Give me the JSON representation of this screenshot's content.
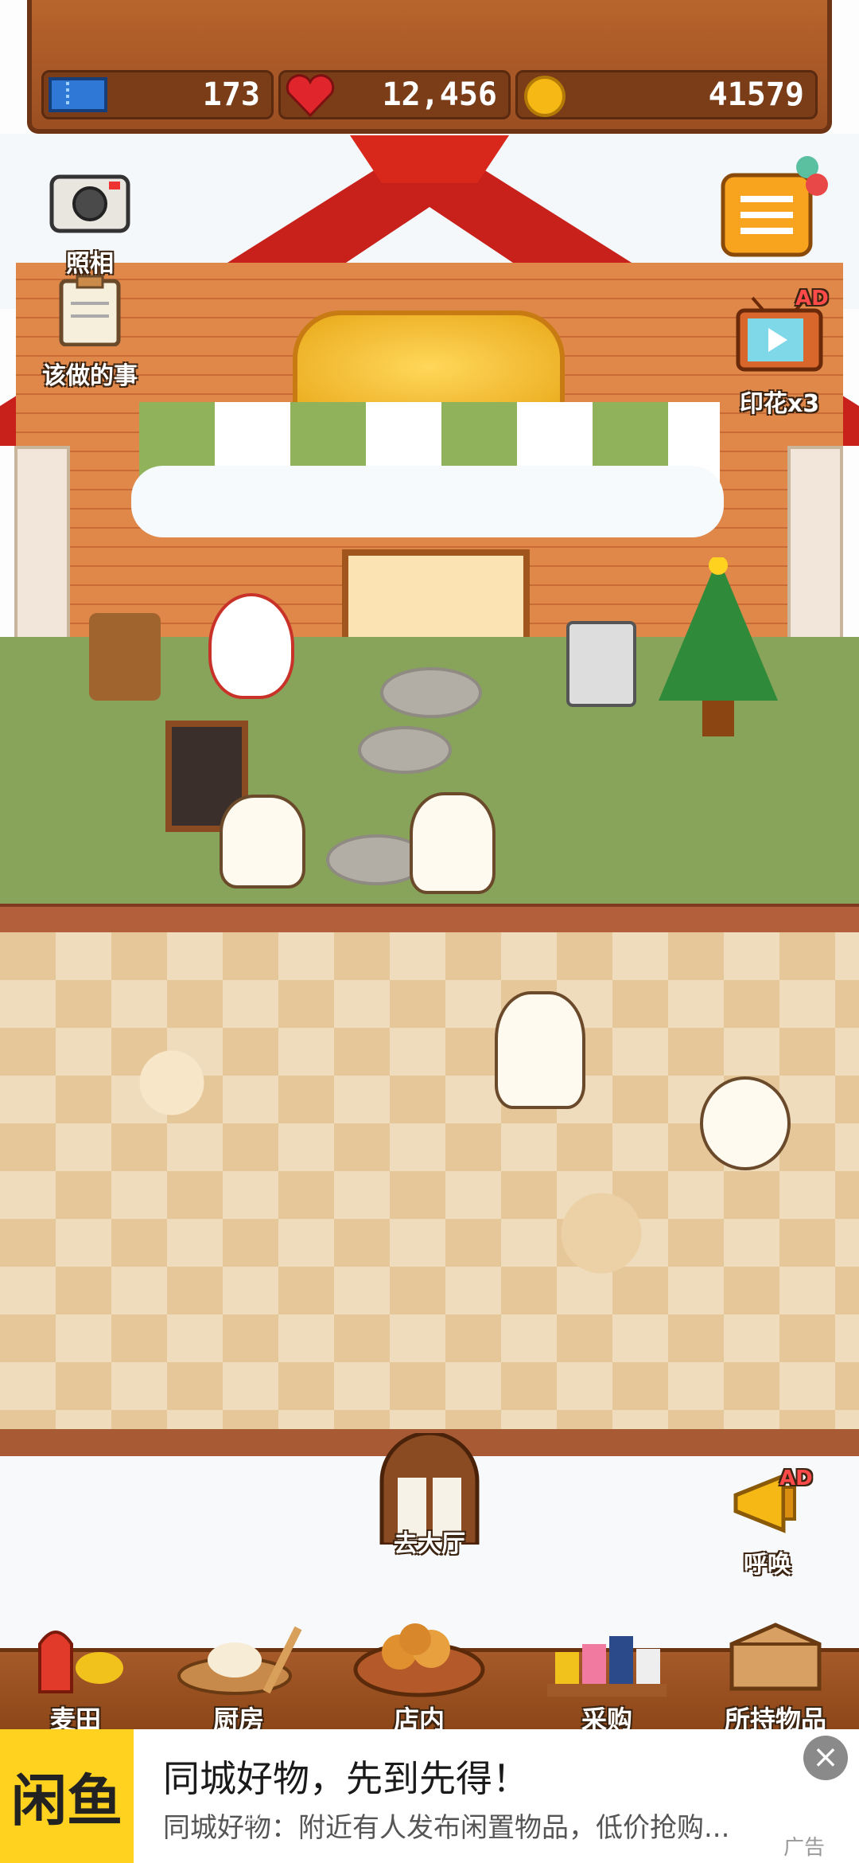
{
  "resources": {
    "tickets": "173",
    "hearts": "12,456",
    "coins": "41579"
  },
  "side_left": {
    "camera_label": "照相",
    "todo_label": "该做的事"
  },
  "side_right": {
    "menu_label": "",
    "stamp_label": "印花x3",
    "stamp_ad": "AD",
    "call_label": "呼唤",
    "call_ad": "AD"
  },
  "center": {
    "go_hall_label": "去大厅"
  },
  "nav": [
    {
      "label": "麦田"
    },
    {
      "label": "厨房"
    },
    {
      "label": "店内"
    },
    {
      "label": "采购"
    },
    {
      "label": "所持物品"
    }
  ],
  "ad": {
    "logo": "闲鱼",
    "title": "同城好物，先到先得！",
    "subtitle": "同城好物：附近有人发布闲置物品，低价抢购...",
    "tag": "广告",
    "close": "×"
  },
  "colors": {
    "wood": "#9b4f22",
    "lawn": "#88a35a",
    "roof": "#c8201a",
    "awning_green": "#8fb25a"
  }
}
